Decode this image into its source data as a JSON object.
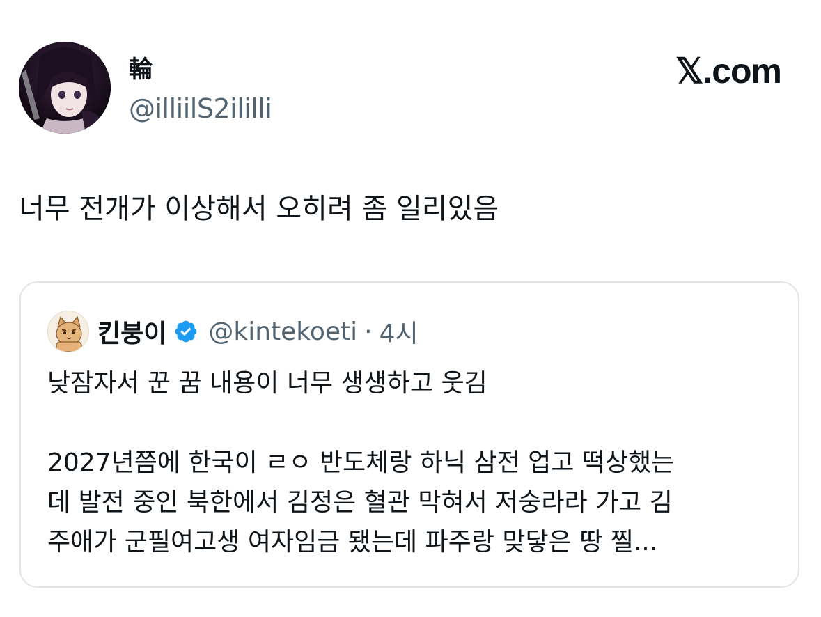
{
  "author": {
    "name": "輪",
    "handle": "@illiilS2ililli"
  },
  "brand": {
    "label": "𝕏.com"
  },
  "tweet": {
    "text": "너무 전개가 이상해서 오히려 좀 일리있음"
  },
  "quoted": {
    "name": "킨붕이",
    "handle": "@kintekoeti",
    "separator": "·",
    "time": "4시",
    "lines": [
      "낮잠자서 꾼 꿈 내용이 너무 생생하고 웃김",
      "",
      "2027년쯤에 한국이 ㄹㅇ 반도체랑 하닉 삼전 업고 떡상했는",
      "데 발전 중인 북한에서 김정은 혈관 막혀서 저숭라라 가고 김",
      "주애가 군필여고생 여자임금 됐는데 파주랑 맞닿은 땅 찔..."
    ]
  },
  "colors": {
    "text": "#0f1419",
    "secondary": "#536471",
    "verified_blue": "#1d9bf0",
    "border": "#e1e6ea"
  },
  "icons": {
    "verified": "verified-badge-icon",
    "brand": "x-logo"
  }
}
